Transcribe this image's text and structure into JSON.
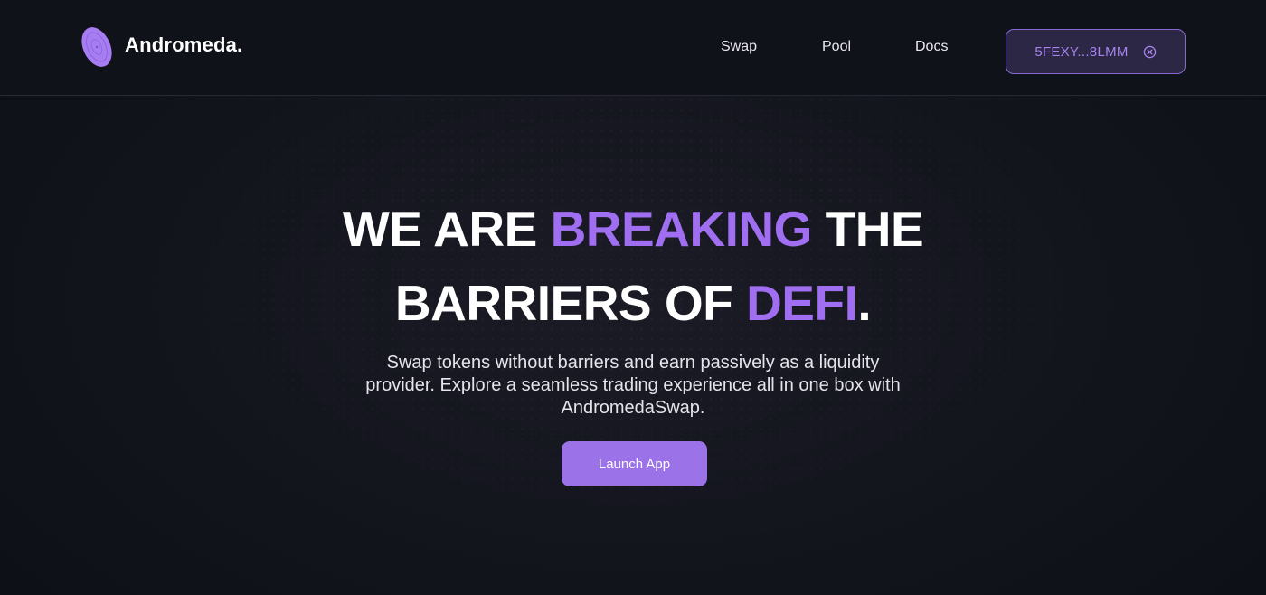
{
  "header": {
    "logo_icon": "andromeda-galaxy-icon",
    "brand_name": "Andromeda.",
    "nav": {
      "swap": "Swap",
      "pool": "Pool",
      "docs": "Docs"
    },
    "wallet": {
      "address": "5FEXY...8LMM",
      "disconnect_icon": "close-circle-icon"
    }
  },
  "hero": {
    "headline": {
      "line1_part1": "WE ARE ",
      "line1_accent": "BREAKING",
      "line1_part2": " THE",
      "line2_part1": "BARRIERS OF ",
      "line2_accent": "DEFI",
      "line2_part2": "."
    },
    "subtitle": "Swap tokens without barriers and earn passively as a liquidity provider. Explore a seamless trading experience all in one box with AndromedaSwap.",
    "cta_label": "Launch App"
  },
  "colors": {
    "background": "#0f1119",
    "accent": "#a06ef0",
    "button": "#9b72e8",
    "wallet_border": "#8a68d4",
    "wallet_bg": "#2c2744"
  }
}
